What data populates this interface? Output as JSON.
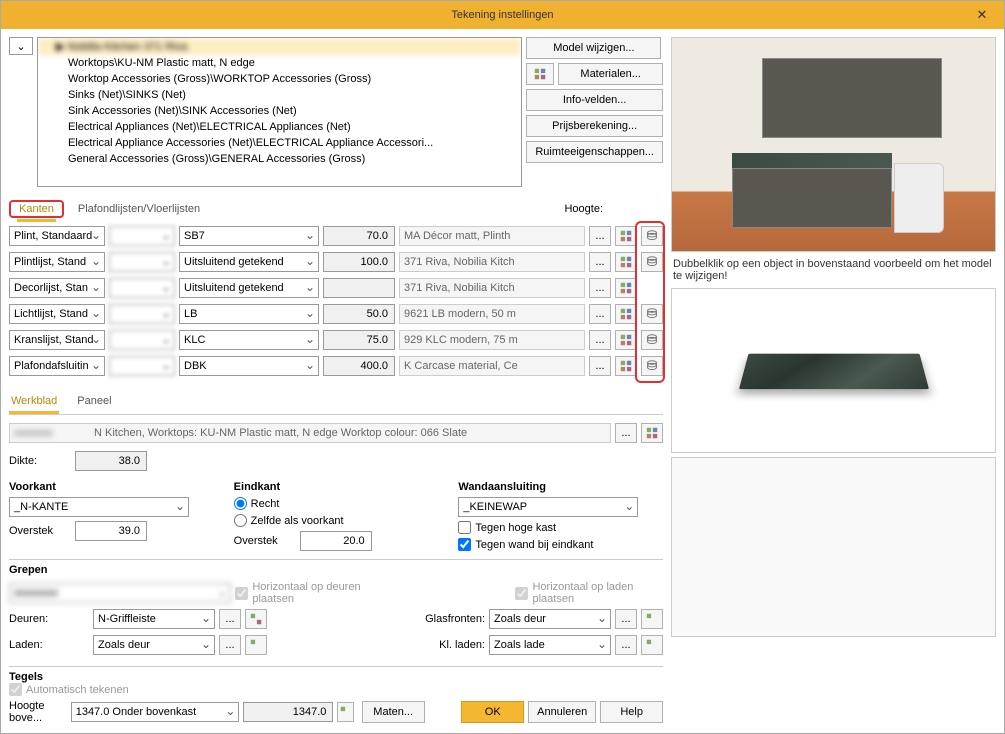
{
  "title": "Tekening instellingen",
  "catalog": {
    "selected": "Nobilia Kitchen 371 Riva",
    "items": [
      "Worktops\\KU-NM Plastic matt, N edge",
      "Worktop Accessories (Gross)\\WORKTOP Accessories (Gross)",
      "Sinks (Net)\\SINKS (Net)",
      "Sink Accessories (Net)\\SINK Accessories (Net)",
      "Electrical Appliances (Net)\\ELECTRICAL Appliances (Net)",
      "Electrical Appliance Accessories (Net)\\ELECTRICAL Appliance Accessori...",
      "General Accessories (Gross)\\GENERAL Accessories (Gross)"
    ]
  },
  "right_buttons": {
    "model": "Model wijzigen...",
    "materials": "Materialen...",
    "info": "Info-velden...",
    "pricing": "Prijsberekening...",
    "room": "Ruimteeigenschappen..."
  },
  "preview_hint": "Dubbelklik op een object in bovenstaand voorbeeld om het model te wijzigen!",
  "tabs": {
    "kanten": "Kanten",
    "plafond": "Plafondlijsten/Vloerlijsten",
    "hoogte_label": "Hoogte:"
  },
  "rows": [
    {
      "type": "Plint, Standaard",
      "code": "SB7",
      "height": "70.0",
      "desc": "MA Décor matt, Plinth"
    },
    {
      "type": "Plintlijst, Stand",
      "code": "Uitsluitend getekend",
      "height": "100.0",
      "desc": "371 Riva, Nobilia Kitch"
    },
    {
      "type": "Decorlijst, Stan",
      "code": "Uitsluitend getekend",
      "height": "",
      "desc": "371 Riva, Nobilia Kitch"
    },
    {
      "type": "Lichtlijst, Stand",
      "code": "LB",
      "height": "50.0",
      "desc": "9621 LB modern, 50 m"
    },
    {
      "type": "Kranslijst, Stand",
      "code": "KLC",
      "height": "75.0",
      "desc": "929 KLC modern, 75 m"
    },
    {
      "type": "Plafondafsluitin",
      "code": "DBK",
      "height": "400.0",
      "desc": "K Carcase material, Ce"
    }
  ],
  "worktop_tabs": {
    "werkblad": "Werkblad",
    "paneel": "Paneel"
  },
  "worktop": {
    "desc": "N Kitchen, Worktops: KU-NM Plastic matt, N edge Worktop colour: 066 Slate",
    "dikte_label": "Dikte:",
    "dikte": "38.0",
    "voorkant_label": "Voorkant",
    "voorkant_dd": "_N-KANTE",
    "overstek_label": "Overstek",
    "overstek_front": "39.0",
    "eindkant_label": "Eindkant",
    "recht": "Recht",
    "zelfde": "Zelfde als voorkant",
    "overstek_end": "20.0",
    "wand_label": "Wandaansluiting",
    "wand_dd": "_KEINEWAP",
    "tegen_hoge": "Tegen hoge kast",
    "tegen_wand": "Tegen wand bij eindkant"
  },
  "grepen": {
    "title": "Grepen",
    "horiz_deur": "Horizontaal op deuren plaatsen",
    "horiz_laden": "Horizontaal op laden plaatsen",
    "deuren_label": "Deuren:",
    "deuren_val": "N-Griffleiste",
    "laden_label": "Laden:",
    "laden_val": "Zoals deur",
    "glas_label": "Glasfronten:",
    "glas_val": "Zoals deur",
    "kl_laden_label": "Kl. laden:",
    "kl_laden_val": "Zoals lade"
  },
  "tegels": {
    "title": "Tegels",
    "auto": "Automatisch tekenen",
    "hoogte_label": "Hoogte bove...",
    "hoogte_dd": "1347.0 Onder bovenkast",
    "hoogte_val": "1347.0"
  },
  "bottom": {
    "maten": "Maten...",
    "ok": "OK",
    "cancel": "Annuleren",
    "help": "Help"
  }
}
